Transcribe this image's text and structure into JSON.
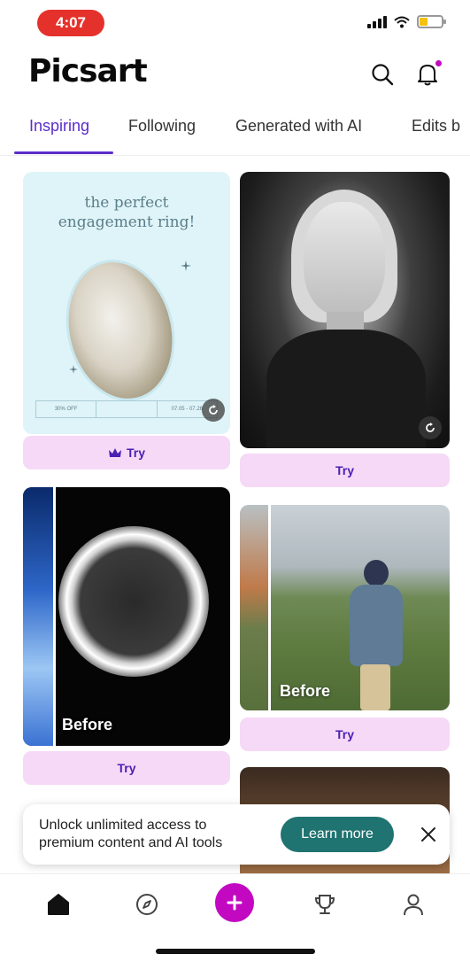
{
  "status_bar": {
    "time": "4:07"
  },
  "header": {
    "logo": "Picsart",
    "icons": [
      "search-icon",
      "bell-icon"
    ],
    "notification_dot_color": "#c209c1"
  },
  "tabs": [
    {
      "label": "Inspiring",
      "active": true
    },
    {
      "label": "Following",
      "active": false
    },
    {
      "label": "Generated with AI",
      "active": false
    },
    {
      "label": "Edits b",
      "active": false
    }
  ],
  "feed": {
    "cards": [
      {
        "title_line1": "the perfect",
        "title_line2": "engagement ring!",
        "strip_left": "30% OFF",
        "strip_right": "07.05 - 07.26",
        "try_label": "Try",
        "premium": true
      },
      {
        "try_label": "Try"
      },
      {
        "before_label": "Before",
        "try_label": "Try"
      },
      {
        "before_label": "Before",
        "try_label": "Try"
      }
    ]
  },
  "promo": {
    "text_line1": "Unlock unlimited access to",
    "text_line2": "premium content and AI tools",
    "button_label": "Learn more",
    "button_color": "#1f7370"
  },
  "bottom_nav": {
    "items": [
      "home-icon",
      "discover-icon",
      "add-icon",
      "challenges-icon",
      "profile-icon"
    ],
    "accent": "#c209c1"
  }
}
